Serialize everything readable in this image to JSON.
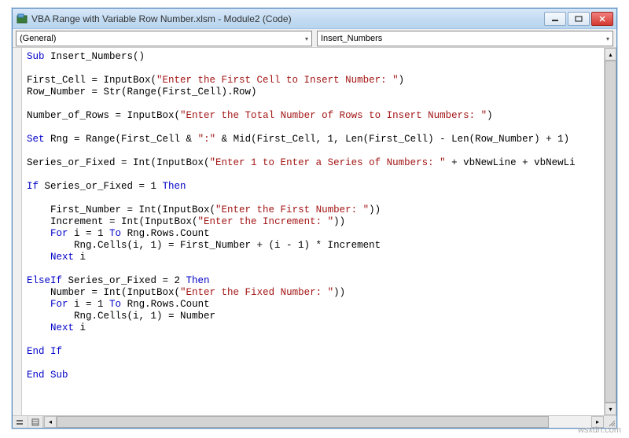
{
  "titlebar": {
    "title": "VBA Range with Variable Row Number.xlsm - Module2 (Code)"
  },
  "dropdowns": {
    "left": "(General)",
    "right": "Insert_Numbers"
  },
  "code": {
    "l01a": "Sub",
    "l01b": " Insert_Numbers()",
    "l02": "",
    "l03a": "First_Cell = InputBox(",
    "l03b": "\"Enter the First Cell to Insert Number: \"",
    "l03c": ")",
    "l04a": "Row_Number = Str(Range(First_Cell).Row)",
    "l05": "",
    "l06a": "Number_of_Rows = InputBox(",
    "l06b": "\"Enter the Total Number of Rows to Insert Numbers: \"",
    "l06c": ")",
    "l07": "",
    "l08a": "Set",
    "l08b": " Rng = Range(First_Cell & ",
    "l08c": "\":\"",
    "l08d": " & Mid(First_Cell, 1, Len(First_Cell) - Len(Row_Number) + 1)",
    "l09": "",
    "l10a": "Series_or_Fixed = Int(InputBox(",
    "l10b": "\"Enter 1 to Enter a Series of Numbers: \"",
    "l10c": " + vbNewLine + vbNewLi",
    "l11": "",
    "l12a": "If",
    "l12b": " Series_or_Fixed = 1 ",
    "l12c": "Then",
    "l13": "",
    "l14a": "    First_Number = Int(InputBox(",
    "l14b": "\"Enter the First Number: \"",
    "l14c": "))",
    "l15a": "    Increment = Int(InputBox(",
    "l15b": "\"Enter the Increment: \"",
    "l15c": "))",
    "l16a": "    ",
    "l16b": "For",
    "l16c": " i = 1 ",
    "l16d": "To",
    "l16e": " Rng.Rows.Count",
    "l17a": "        Rng.Cells(i, 1) = First_Number + (i - 1) * Increment",
    "l18a": "    ",
    "l18b": "Next",
    "l18c": " i",
    "l19": "",
    "l20a": "ElseIf",
    "l20b": " Series_or_Fixed = 2 ",
    "l20c": "Then",
    "l21a": "    Number = Int(InputBox(",
    "l21b": "\"Enter the Fixed Number: \"",
    "l21c": "))",
    "l22a": "    ",
    "l22b": "For",
    "l22c": " i = 1 ",
    "l22d": "To",
    "l22e": " Rng.Rows.Count",
    "l23a": "        Rng.Cells(i, 1) = Number",
    "l24a": "    ",
    "l24b": "Next",
    "l24c": " i",
    "l25": "",
    "l26a": "End If",
    "l27": "",
    "l28a": "End Sub"
  },
  "watermark": "wsxdn.com"
}
